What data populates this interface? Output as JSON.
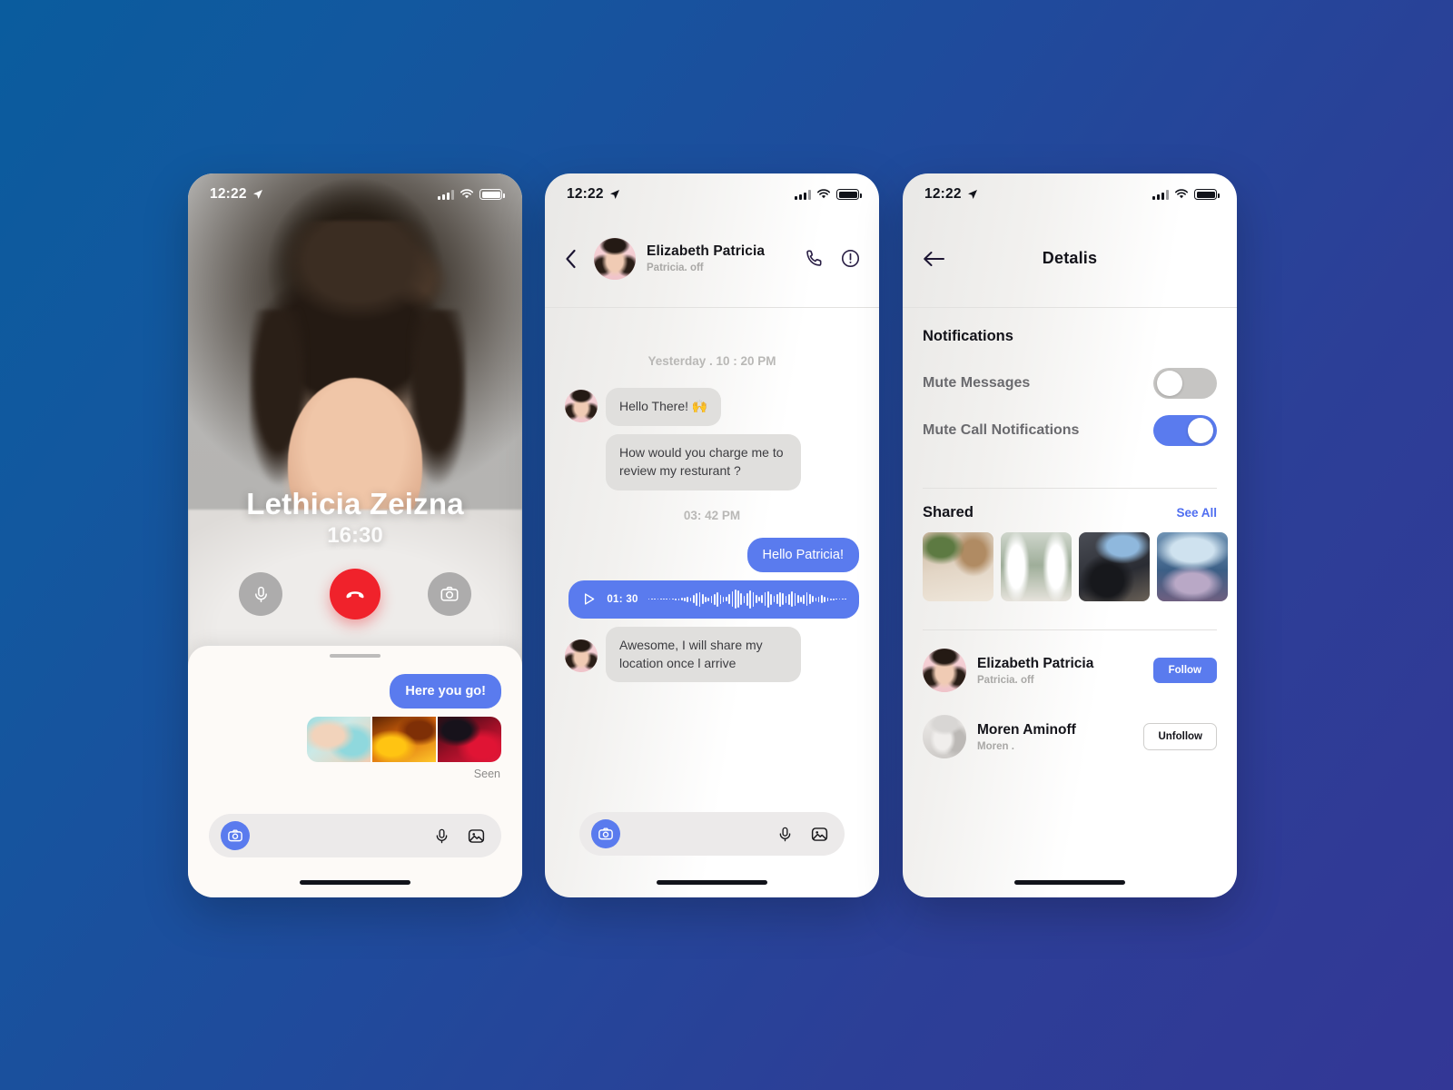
{
  "background": {
    "from": "#0a5c9e",
    "to": "#333796"
  },
  "theme": {
    "accent": "#5a7bee",
    "link": "#4f6ef0",
    "danger": "#f0222b",
    "toggle_on": "#5a7bee",
    "toggle_off": "#c6c5c3"
  },
  "status_bar": {
    "time": "12:22",
    "location_icon": "location-arrow-icon",
    "signal_icon": "cellular-signal-icon",
    "wifi_icon": "wifi-icon",
    "battery_icon": "battery-full-icon"
  },
  "call_screen": {
    "name": "Lethicia Zeizna",
    "duration": "16:30",
    "controls": [
      {
        "name": "mute-button",
        "icon": "microphone-icon"
      },
      {
        "name": "end-call-button",
        "icon": "phone-hangup-icon"
      },
      {
        "name": "camera-button",
        "icon": "camera-icon"
      }
    ],
    "sheet": {
      "outgoing_message": "Here you go!",
      "attachments": [
        "ink-blue-photo",
        "ink-orange-photo",
        "ink-red-photo"
      ],
      "receipt": "Seen"
    },
    "composer": {
      "camera_icon": "camera-icon",
      "mic_icon": "microphone-icon",
      "gallery_icon": "image-icon",
      "placeholder": ""
    }
  },
  "chat_screen": {
    "header": {
      "back_icon": "chevron-left-icon",
      "name": "Elizabeth Patricia",
      "status": "Patricia. off",
      "call_icon": "phone-icon",
      "info_icon": "info-circle-icon"
    },
    "separators": {
      "day": "Yesterday . 10 : 20 PM",
      "time": "03: 42 PM"
    },
    "messages": [
      {
        "side": "in",
        "text": "Hello There!  🙌"
      },
      {
        "side": "in",
        "text": "How would you charge me to review my resturant ?"
      },
      {
        "side": "out",
        "text": "Hello Patricia!"
      },
      {
        "side": "out",
        "type": "voice",
        "duration": "01: 30",
        "play_icon": "play-icon"
      },
      {
        "side": "in",
        "text": "Awesome, I will share my location once l arrive"
      }
    ],
    "composer": {
      "camera_icon": "camera-icon",
      "mic_icon": "microphone-icon",
      "gallery_icon": "image-icon",
      "placeholder": ""
    }
  },
  "details_screen": {
    "back_icon": "arrow-left-icon",
    "title": "Detalis",
    "notifications": {
      "heading": "Notifications",
      "items": [
        {
          "label": "Mute Messages",
          "on": false
        },
        {
          "label": "Mute Call Notifications",
          "on": true
        }
      ]
    },
    "shared": {
      "heading": "Shared",
      "see_all": "See All",
      "thumbs": [
        "cafe-interior-photo",
        "wedding-hall-photo",
        "lounge-terrace-photo",
        "sea-view-restaurant-photo"
      ]
    },
    "people": [
      {
        "name": "Elizabeth Patricia",
        "sub": "Patricia. off",
        "action": "Follow",
        "style": "primary"
      },
      {
        "name": "Moren Aminoff",
        "sub": "Moren .",
        "action": "Unfollow",
        "style": "outline"
      }
    ]
  }
}
